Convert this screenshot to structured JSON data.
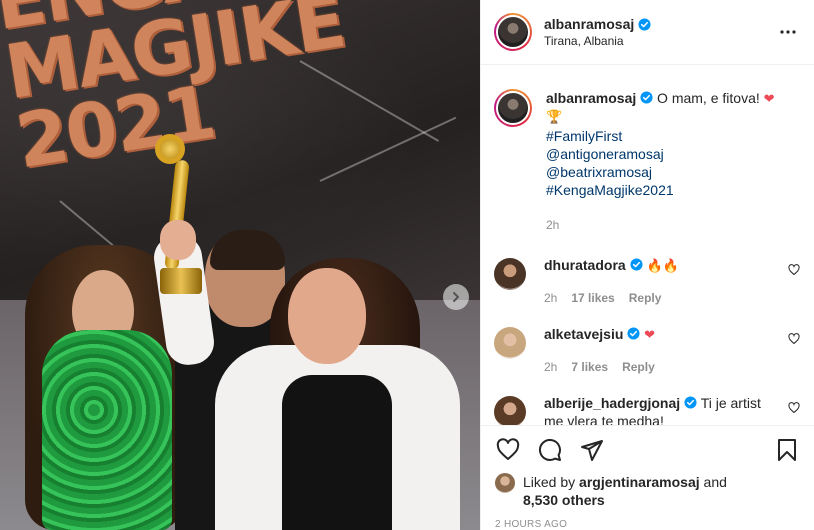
{
  "photo": {
    "stage_text_line1": "ENGA",
    "stage_text_line2": "MAGJIKE",
    "stage_text_line3": "2021"
  },
  "header": {
    "username": "albanramosaj",
    "location": "Tirana, Albania"
  },
  "caption": {
    "username": "albanramosaj",
    "text": "O mam, e fitova!",
    "emoji_heart": "❤",
    "emoji_trophy": "🏆",
    "tags": [
      "#FamilyFirst",
      "@antigoneramosaj",
      "@beatrixramosaj",
      "#KengaMagjike2021"
    ],
    "time": "2h"
  },
  "comments": [
    {
      "username": "dhuratadora",
      "text": "🔥🔥",
      "time": "2h",
      "likes": "17 likes",
      "reply": "Reply"
    },
    {
      "username": "alketavejsiu",
      "text": "❤",
      "time": "2h",
      "likes": "7 likes",
      "reply": "Reply"
    },
    {
      "username": "alberije_hadergjonaj",
      "text": "Ti je artist me vlera te medha!"
    }
  ],
  "likes": {
    "prefix": "Liked by",
    "user": "argjentinaramosaj",
    "and": "and",
    "others": "8,530 others"
  },
  "timestamp": "2 HOURS AGO",
  "colors": {
    "verified": "#0095f6",
    "link": "#00376b",
    "heart": "#ed4956",
    "muted": "#8e8e8e"
  }
}
